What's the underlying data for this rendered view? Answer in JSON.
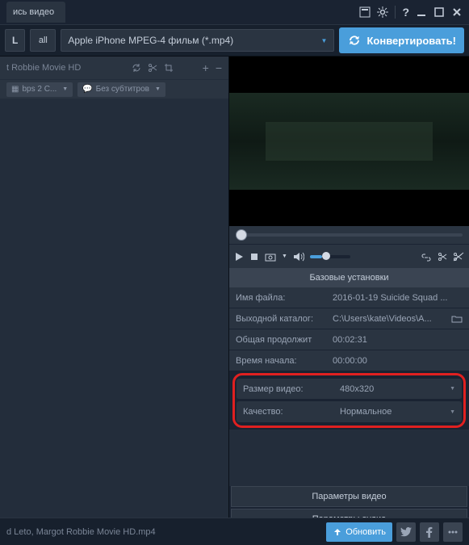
{
  "titlebar": {
    "tab_label": "ись видео"
  },
  "toolbar": {
    "l_label": "L",
    "all_label": "all",
    "format": "Apple iPhone MPEG-4 фильм (*.mp4)",
    "convert": "Конвертировать!"
  },
  "file": {
    "name": "t Robbie Movie HD",
    "codec": "bps 2 C...",
    "subs": "Без субтитров"
  },
  "settings": {
    "header": "Базовые установки",
    "rows": [
      {
        "label": "Имя файла:",
        "value": "2016-01-19 Suicide Squad ..."
      },
      {
        "label": "Выходной каталог:",
        "value": "C:\\Users\\kate\\Videos\\A..."
      },
      {
        "label": "Общая продолжит",
        "value": "00:02:31"
      },
      {
        "label": "Время начала:",
        "value": "00:00:00"
      }
    ],
    "highlight": [
      {
        "label": "Размер видео:",
        "value": "480x320"
      },
      {
        "label": "Качество:",
        "value": "Нормальное"
      }
    ],
    "params_video": "Параметры видео",
    "params_audio": "Параметры аудио"
  },
  "footer": {
    "status": "d Leto, Margot Robbie Movie HD.mp4",
    "refresh": "Обновить"
  }
}
